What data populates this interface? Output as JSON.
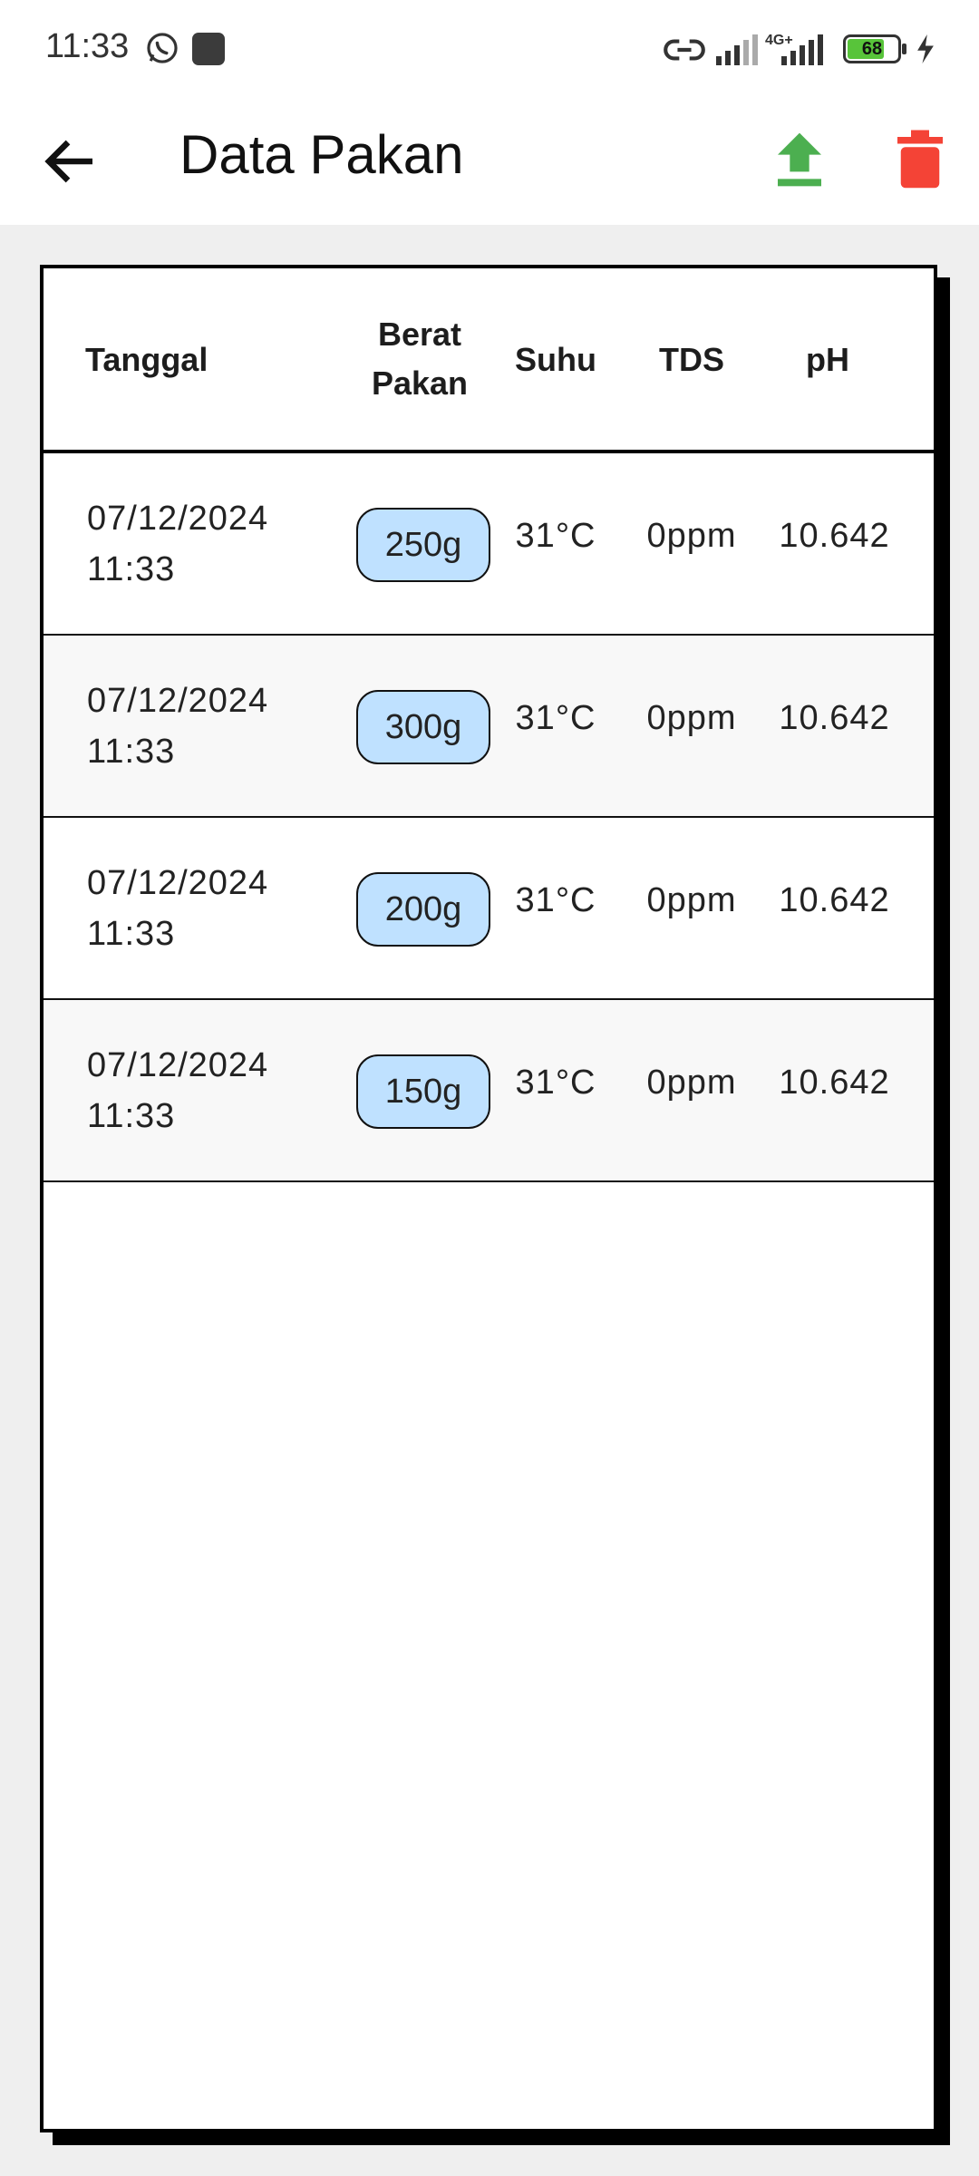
{
  "status_bar": {
    "time": "11:33",
    "network": "4G+",
    "battery": "68"
  },
  "app_bar": {
    "title": "Data Pakan",
    "icons": [
      "back-arrow-icon",
      "upload-icon",
      "trash-icon"
    ],
    "colors": {
      "upload": "#4caf50",
      "delete": "#f44336"
    }
  },
  "table": {
    "headers": {
      "date": "Tanggal",
      "weight_line1": "Berat",
      "weight_line2": "Pakan",
      "temp": "Suhu",
      "tds": "TDS",
      "ph": "pH"
    },
    "rows": [
      {
        "date": "07/12/2024",
        "time": "11:33",
        "weight": "250g",
        "temp": "31°C",
        "tds": "0ppm",
        "ph": "10.642"
      },
      {
        "date": "07/12/2024",
        "time": "11:33",
        "weight": "300g",
        "temp": "31°C",
        "tds": "0ppm",
        "ph": "10.642"
      },
      {
        "date": "07/12/2024",
        "time": "11:33",
        "weight": "200g",
        "temp": "31°C",
        "tds": "0ppm",
        "ph": "10.642"
      },
      {
        "date": "07/12/2024",
        "time": "11:33",
        "weight": "150g",
        "temp": "31°C",
        "tds": "0ppm",
        "ph": "10.642"
      }
    ],
    "colors": {
      "chip": "#bfe1ff",
      "border": "#000000"
    }
  }
}
